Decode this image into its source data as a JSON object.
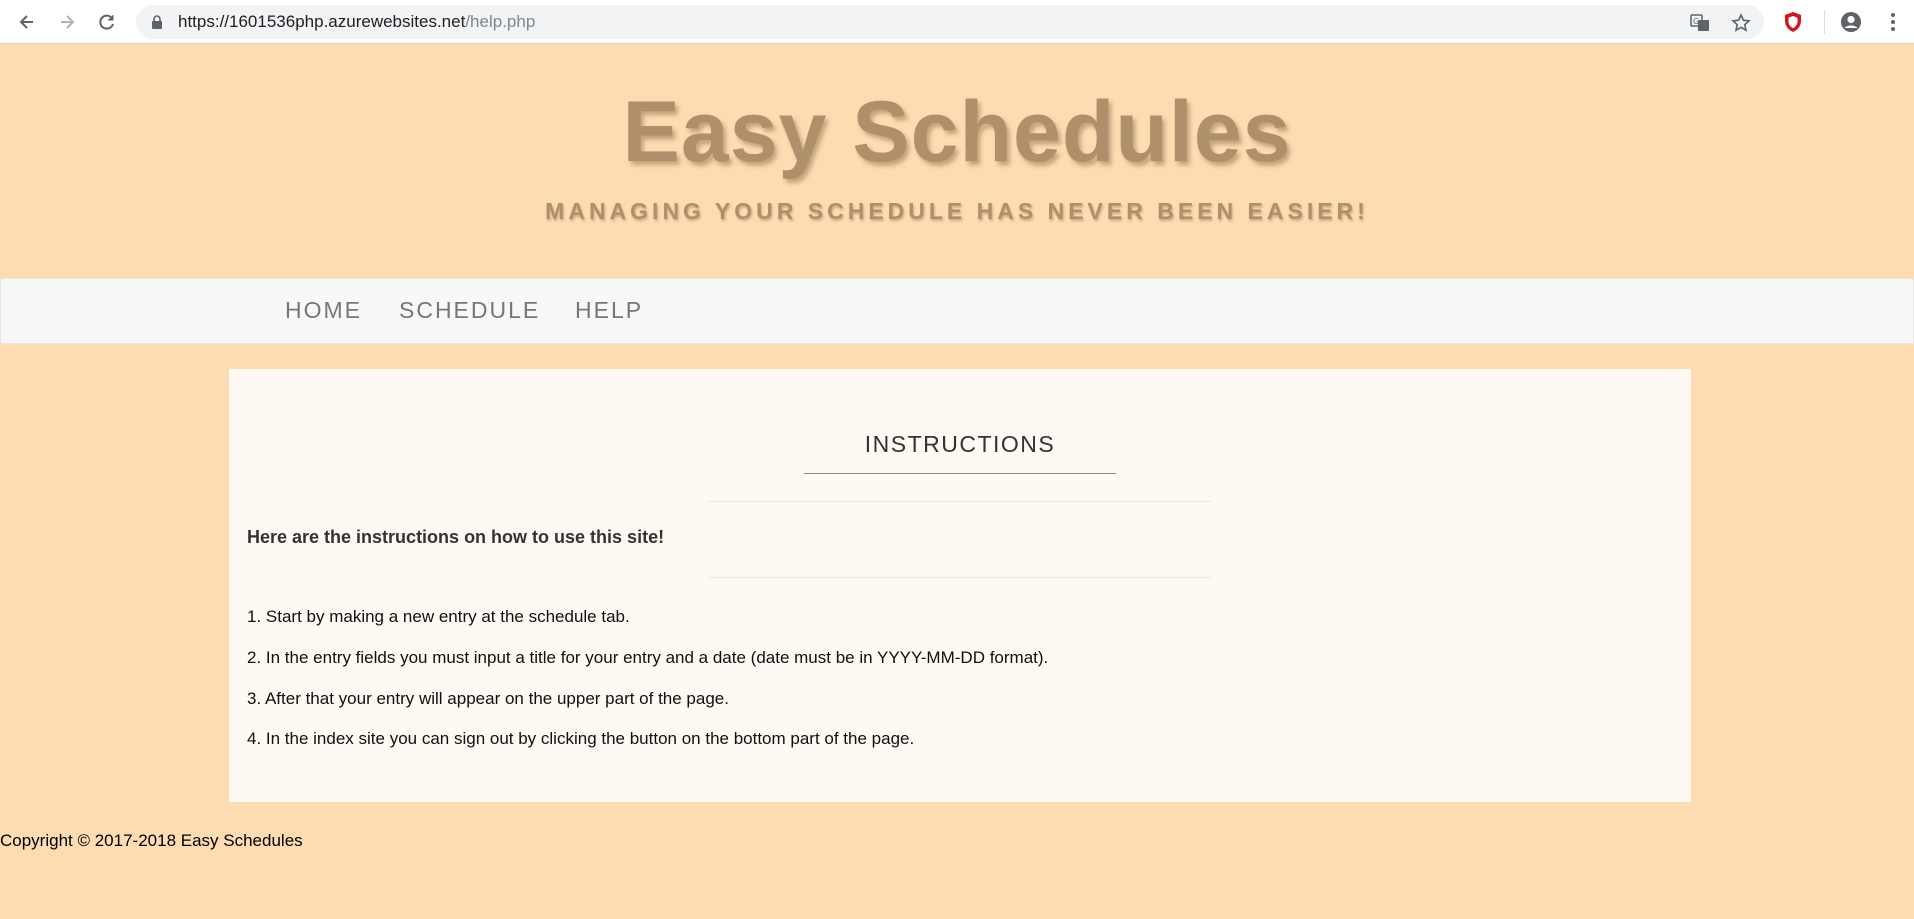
{
  "browser": {
    "url_host": "https://1601536php.azurewebsites.net",
    "url_path": "/help.php"
  },
  "header": {
    "title": "Easy Schedules",
    "subtitle": "MANAGING YOUR SCHEDULE HAS NEVER BEEN EASIER!"
  },
  "nav": {
    "items": [
      {
        "label": "HOME"
      },
      {
        "label": "SCHEDULE"
      },
      {
        "label": "HELP"
      }
    ]
  },
  "content": {
    "heading": "INSTRUCTIONS",
    "intro": "Here are the instructions on how to use this site!",
    "steps": [
      "1. Start by making a new entry at the schedule tab.",
      "2. In the entry fields you must input a title for your entry and a date (date must be in YYYY-MM-DD format).",
      "3. After that your entry will appear on the upper part of the page.",
      "4. In the index site you can sign out by clicking the button on the bottom part of the page."
    ]
  },
  "footer": {
    "copyright": "Copyright © 2017-2018 Easy Schedules"
  },
  "colors": {
    "page_bg": "#fddcb2",
    "title": "#b08f6b",
    "panel_bg": "#fef9f2",
    "nav_bg": "#f8f8f8"
  }
}
